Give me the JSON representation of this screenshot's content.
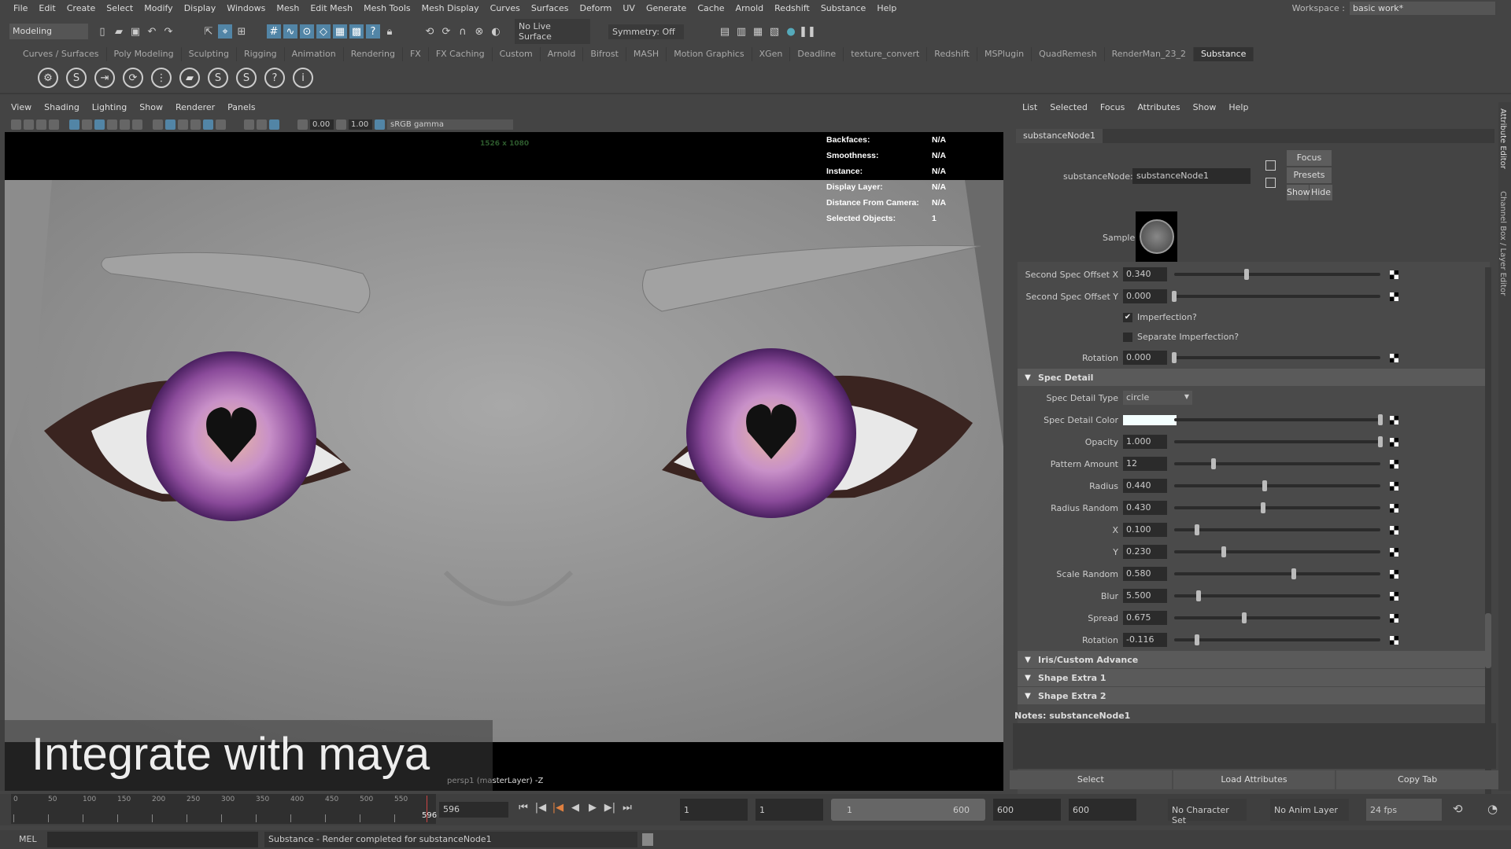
{
  "menubar": {
    "items": [
      "File",
      "Edit",
      "Create",
      "Select",
      "Modify",
      "Display",
      "Windows",
      "Mesh",
      "Edit Mesh",
      "Mesh Tools",
      "Mesh Display",
      "Curves",
      "Surfaces",
      "Deform",
      "UV",
      "Generate",
      "Cache",
      "Arnold",
      "Redshift",
      "Substance",
      "Help"
    ],
    "workspace_label": "Workspace :",
    "workspace_value": "basic work*"
  },
  "toolbar": {
    "mode": "Modeling",
    "live_surface": "No Live Surface",
    "symmetry": "Symmetry: Off"
  },
  "shelf": {
    "tabs": [
      "Curves / Surfaces",
      "Poly Modeling",
      "Sculpting",
      "Rigging",
      "Animation",
      "Rendering",
      "FX",
      "FX Caching",
      "Custom",
      "Arnold",
      "Bifrost",
      "MASH",
      "Motion Graphics",
      "XGen",
      "Deadline",
      "texture_convert",
      "Redshift",
      "MSPlugin",
      "QuadRemesh",
      "RenderMan_23_2",
      "Substance"
    ],
    "active": "Substance",
    "icons": [
      "gear-icon",
      "substance-icon",
      "export-icon",
      "refresh-icon",
      "graph-icon",
      "folder-icon",
      "substance-s-icon",
      "substance-s2-icon",
      "help-icon",
      "info-icon"
    ]
  },
  "viewport": {
    "menu": [
      "View",
      "Shading",
      "Lighting",
      "Show",
      "Renderer",
      "Panels"
    ],
    "exposure": "0.00",
    "gamma": "1.00",
    "color_space": "sRGB gamma",
    "resolution": "1526 x 1080",
    "camera": "persp1 (masterLayer) -Z",
    "hud": [
      {
        "k": "Backfaces:",
        "v": "N/A"
      },
      {
        "k": "Smoothness:",
        "v": "N/A"
      },
      {
        "k": "Instance:",
        "v": "N/A"
      },
      {
        "k": "Display Layer:",
        "v": "N/A"
      },
      {
        "k": "Distance From Camera:",
        "v": "N/A"
      },
      {
        "k": "Selected Objects:",
        "v": "1"
      }
    ],
    "caption": "Integrate with maya",
    "iris_color": "#7a3c8c"
  },
  "attribute_editor": {
    "menu": [
      "List",
      "Selected",
      "Focus",
      "Attributes",
      "Show",
      "Help"
    ],
    "tab": "substanceNode1",
    "node_label": "substanceNode:",
    "node_value": "substanceNode1",
    "focus": "Focus",
    "presets": "Presets",
    "show": "Show",
    "hide": "Hide",
    "sample_label": "Sample",
    "rows": [
      {
        "type": "slider",
        "label": "Second Spec  Offset X",
        "value": "0.340",
        "level": 0.35
      },
      {
        "type": "slider",
        "label": "Second Spec  Offset Y",
        "value": "0.000",
        "level": 0.0
      },
      {
        "type": "check",
        "label": "Imperfection?",
        "checked": true
      },
      {
        "type": "check",
        "label": "Separate Imperfection?",
        "checked": false
      },
      {
        "type": "slider",
        "label": "Rotation",
        "value": "0.000",
        "level": 0.0
      },
      {
        "type": "header",
        "label": "Spec Detail"
      },
      {
        "type": "enum",
        "label": "Spec Detail Type",
        "value": "circle"
      },
      {
        "type": "color",
        "label": "Spec Detail Color",
        "color": "#f4ffff",
        "level": 1.0
      },
      {
        "type": "slider",
        "label": "Opacity",
        "value": "1.000",
        "level": 1.0
      },
      {
        "type": "slider",
        "label": "Pattern Amount",
        "value": "12",
        "level": 0.19
      },
      {
        "type": "slider",
        "label": "Radius",
        "value": "0.440",
        "level": 0.44
      },
      {
        "type": "slider",
        "label": "Radius Random",
        "value": "0.430",
        "level": 0.43
      },
      {
        "type": "slider",
        "label": "X",
        "value": "0.100",
        "level": 0.11
      },
      {
        "type": "slider",
        "label": "Y",
        "value": "0.230",
        "level": 0.24
      },
      {
        "type": "slider",
        "label": "Scale Random",
        "value": "0.580",
        "level": 0.58
      },
      {
        "type": "slider",
        "label": "Blur",
        "value": "5.500",
        "level": 0.12
      },
      {
        "type": "slider",
        "label": "Spread",
        "value": "0.675",
        "level": 0.34
      },
      {
        "type": "slider",
        "label": "Rotation",
        "value": "-0.116",
        "level": 0.11
      },
      {
        "type": "header",
        "label": "Iris/Custom Advance"
      },
      {
        "type": "header",
        "label": "Shape Extra 1"
      },
      {
        "type": "header",
        "label": "Shape Extra 2"
      }
    ],
    "notes_label": "Notes:  substanceNode1",
    "buttons": [
      "Select",
      "Load Attributes",
      "Copy Tab"
    ],
    "side_tabs": [
      "Attribute Editor",
      "Channel Box / Layer Editor"
    ]
  },
  "timeline": {
    "ticks": [
      "0",
      "50",
      "100",
      "150",
      "200",
      "250",
      "300",
      "350",
      "400",
      "450",
      "500",
      "550"
    ],
    "current_marker": "596",
    "current_frame": "596",
    "start": "1",
    "range_start": "1",
    "slider_start": "1",
    "slider_end": "600",
    "range_end": "600",
    "end": "600",
    "character_set": "No Character Set",
    "anim_layer": "No Anim Layer",
    "fps": "24 fps"
  },
  "command_line": {
    "language": "MEL",
    "result": "Substance - Render completed for substanceNode1"
  }
}
